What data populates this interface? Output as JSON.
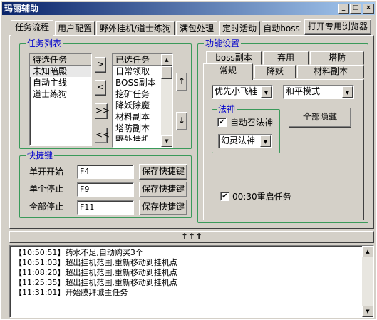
{
  "window": {
    "title": "玛丽辅助"
  },
  "tabs": [
    "任务流程",
    "用户配置",
    "野外挂机/道士练狗",
    "满包处理",
    "定时活动",
    "自动boss"
  ],
  "browser_button": "打开专用浏览器",
  "task_list": {
    "group_title": "任务列表",
    "pending_header": "待选任务",
    "pending": [
      "未知暗殿",
      "自动主线",
      "道士练狗"
    ],
    "selected_header": "已选任务",
    "selected": [
      "日常领取",
      "BOSS副本",
      "挖矿任务",
      "降妖除魔",
      "材料副本",
      "塔防副本",
      "野外挂机"
    ],
    "arrow_right": ">",
    "arrow_left": "<",
    "arrow_all_right": ">>",
    "arrow_all_left": "<<",
    "move_up": "↑",
    "move_down": "↓"
  },
  "hotkeys": {
    "group_title": "快捷键",
    "rows": [
      {
        "label": "单开开始",
        "value": "F4",
        "button": "保存快捷键"
      },
      {
        "label": "单个停止",
        "value": "F9",
        "button": "保存快捷键"
      },
      {
        "label": "全部停止",
        "value": "F11",
        "button": "保存快捷键"
      }
    ]
  },
  "settings": {
    "group_title": "功能设置",
    "tabs_row1": [
      "boss副本",
      "弃用",
      "塔防"
    ],
    "tabs_row2": [
      "常规",
      "降妖",
      "材料副本"
    ],
    "combo1": "优先小飞鞋",
    "combo2": "和平模式",
    "fashen_title": "法神",
    "auto_summon_label": "自动召法神",
    "auto_summon_checked": true,
    "fashen_combo": "幻灵法神",
    "hide_all_button": "全部隐藏",
    "restart_checked": true,
    "restart_label": "00:30重启任务"
  },
  "splitter_label": "↑↑↑",
  "log": [
    "【10:50:51】药水不足,自动购买3个",
    "【10:51:03】超出挂机范围,重新移动到挂机点",
    "【11:08:20】超出挂机范围,重新移动到挂机点",
    "【11:25:35】超出挂机范围,重新移动到挂机点",
    "【11:31:01】开始膜拜城主任务"
  ],
  "icons": {
    "minimize": "minimize-icon",
    "maximize": "maximize-icon",
    "close": "close-icon"
  }
}
